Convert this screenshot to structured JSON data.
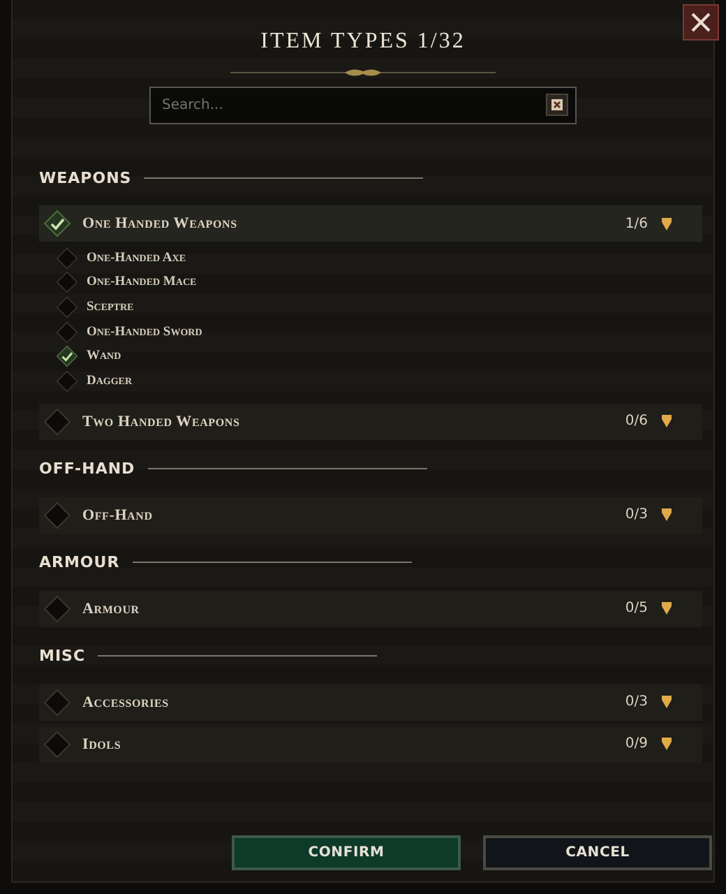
{
  "window": {
    "title": "ITEM TYPES 1/32"
  },
  "search": {
    "placeholder": "Search..."
  },
  "sections": [
    {
      "title": "WEAPONS",
      "groups": [
        {
          "label": "One Handed Weapons",
          "checked": true,
          "count": "1/6",
          "children": [
            {
              "label": "One-Handed Axe",
              "checked": false
            },
            {
              "label": "One-Handed Mace",
              "checked": false
            },
            {
              "label": "Sceptre",
              "checked": false
            },
            {
              "label": "One-Handed Sword",
              "checked": false
            },
            {
              "label": "Wand",
              "checked": true
            },
            {
              "label": "Dagger",
              "checked": false
            }
          ]
        },
        {
          "label": "Two Handed Weapons",
          "checked": false,
          "count": "0/6"
        }
      ]
    },
    {
      "title": "OFF-HAND",
      "groups": [
        {
          "label": "Off-Hand",
          "checked": false,
          "count": "0/3"
        }
      ]
    },
    {
      "title": "ARMOUR",
      "groups": [
        {
          "label": "Armour",
          "checked": false,
          "count": "0/5"
        }
      ]
    },
    {
      "title": "MISC",
      "groups": [
        {
          "label": "Accessories",
          "checked": false,
          "count": "0/3"
        },
        {
          "label": "Idols",
          "checked": false,
          "count": "0/9"
        }
      ]
    }
  ],
  "buttons": [
    {
      "label": "CONFIRM",
      "kind": "primary"
    },
    {
      "label": "CANCEL",
      "kind": "secondary"
    }
  ]
}
